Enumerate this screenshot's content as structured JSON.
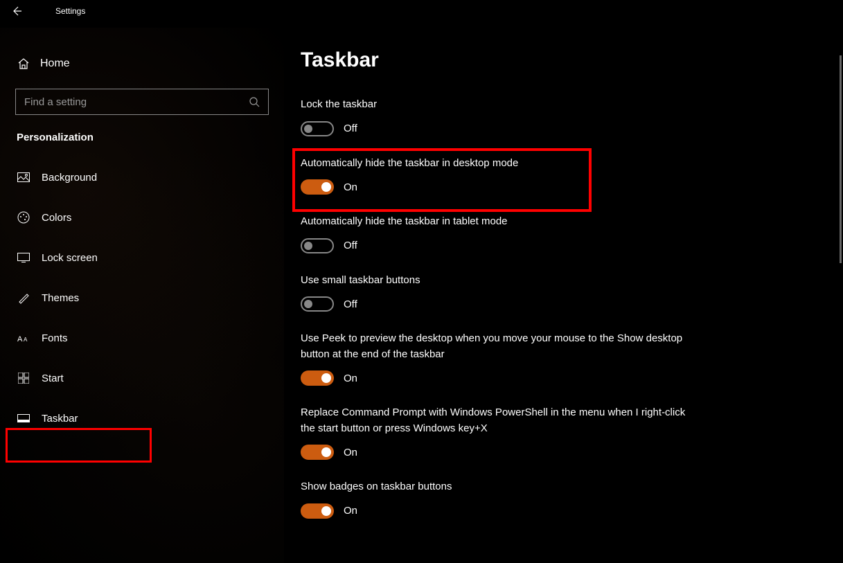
{
  "window": {
    "title": "Settings"
  },
  "sidebar": {
    "home": "Home",
    "search_placeholder": "Find a setting",
    "section": "Personalization",
    "items": [
      {
        "label": "Background"
      },
      {
        "label": "Colors"
      },
      {
        "label": "Lock screen"
      },
      {
        "label": "Themes"
      },
      {
        "label": "Fonts"
      },
      {
        "label": "Start"
      },
      {
        "label": "Taskbar"
      }
    ]
  },
  "main": {
    "title": "Taskbar",
    "settings": [
      {
        "label": "Lock the taskbar",
        "state": "Off",
        "on": false
      },
      {
        "label": "Automatically hide the taskbar in desktop mode",
        "state": "On",
        "on": true
      },
      {
        "label": "Automatically hide the taskbar in tablet mode",
        "state": "Off",
        "on": false
      },
      {
        "label": "Use small taskbar buttons",
        "state": "Off",
        "on": false
      },
      {
        "label": "Use Peek to preview the desktop when you move your mouse to the Show desktop button at the end of the taskbar",
        "state": "On",
        "on": true
      },
      {
        "label": "Replace Command Prompt with Windows PowerShell in the menu when I right-click the start button or press Windows key+X",
        "state": "On",
        "on": true
      },
      {
        "label": "Show badges on taskbar buttons",
        "state": "On",
        "on": true
      }
    ]
  },
  "colors": {
    "accent": "#cc5c10",
    "highlight": "#ff0000"
  }
}
